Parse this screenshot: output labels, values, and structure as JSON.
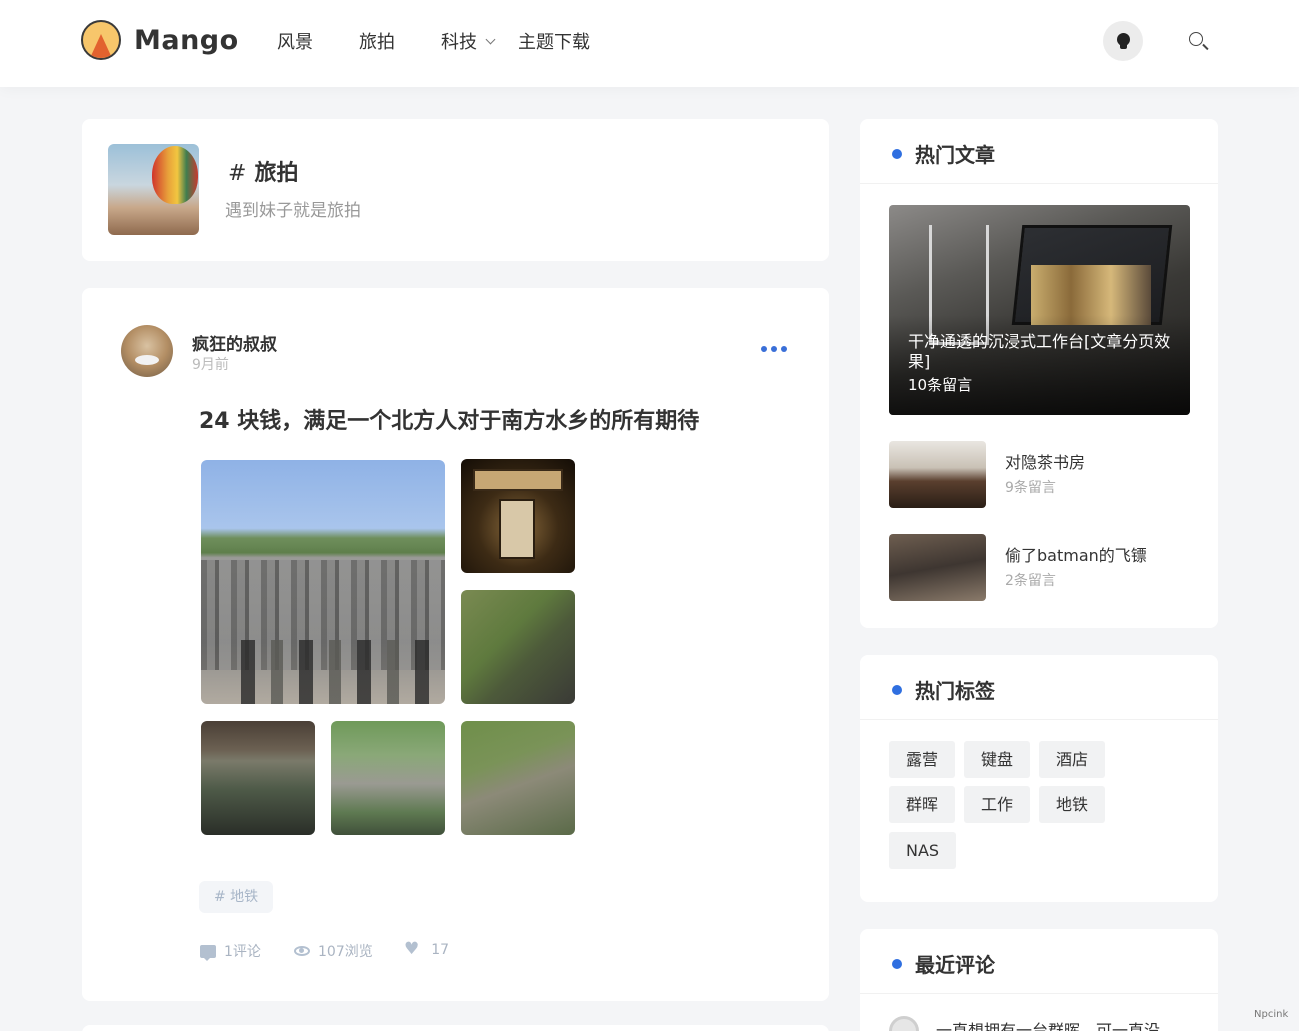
{
  "header": {
    "brand": "Mango",
    "nav": [
      {
        "label": "风景"
      },
      {
        "label": "旅拍"
      },
      {
        "label": "科技"
      },
      {
        "label": "主题下载"
      }
    ],
    "icons": {
      "theme_toggle": "lightbulb-icon",
      "search": "search-icon",
      "dropdown": "chevron-down-icon"
    }
  },
  "category": {
    "hash": "#",
    "name": "旅拍",
    "description": "遇到妹子就是旅拍"
  },
  "post": {
    "author": "疯狂的叔叔",
    "time": "9月前",
    "title": "24 块钱，满足一个北方人对于南方水乡的所有期待",
    "tag": "# 地铁",
    "comments": "1评论",
    "views": "107浏览",
    "likes": "17"
  },
  "sidebar": {
    "hot_title": "热门文章",
    "featured": {
      "title": "干净通透的沉浸式工作台[文章分页效果]",
      "count": "10条留言"
    },
    "hot_list": [
      {
        "title": "对隐茶书房",
        "count": "9条留言"
      },
      {
        "title": "偷了batman的飞镖",
        "count": "2条留言"
      }
    ],
    "tags_title": "热门标签",
    "tags": [
      "露营",
      "键盘",
      "酒店",
      "群晖",
      "工作",
      "地铁",
      "NAS"
    ],
    "recent_title": "最近评论",
    "recent_comment": "一直想拥有一台群晖，可一直没"
  },
  "watermark": "Npcink",
  "colors": {
    "accent": "#2f6fe0",
    "muted": "#aab4c2"
  }
}
